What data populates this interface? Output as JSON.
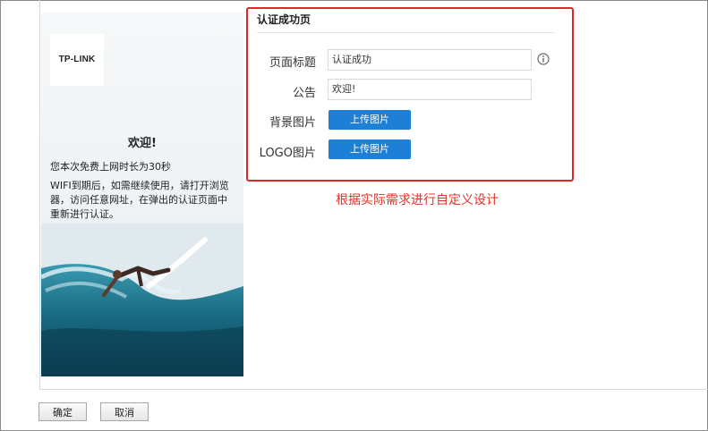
{
  "preview": {
    "logo": "TP-LINK",
    "welcome": "欢迎!",
    "notice_line1": "您本次免费上网时长为30秒",
    "notice_line2": "WIFI到期后，如需继续使用，请打开浏览器，访问任意网址，在弹出的认证页面中重新进行认证。"
  },
  "form": {
    "title": "认证成功页",
    "page_title_label": "页面标题",
    "page_title_value": "认证成功",
    "announcement_label": "公告",
    "announcement_value": "欢迎!",
    "background_label": "背景图片",
    "logo_label": "LOGO图片",
    "upload_label": "上传图片"
  },
  "caption": "根据实际需求进行自定义设计",
  "footer": {
    "confirm_label": "确定",
    "cancel_label": "取消"
  },
  "colors": {
    "highlight_border": "#e2252b",
    "upload_button": "#1e7fd6",
    "caption_text": "#e3342a"
  },
  "icons": {
    "info": "info-icon"
  }
}
